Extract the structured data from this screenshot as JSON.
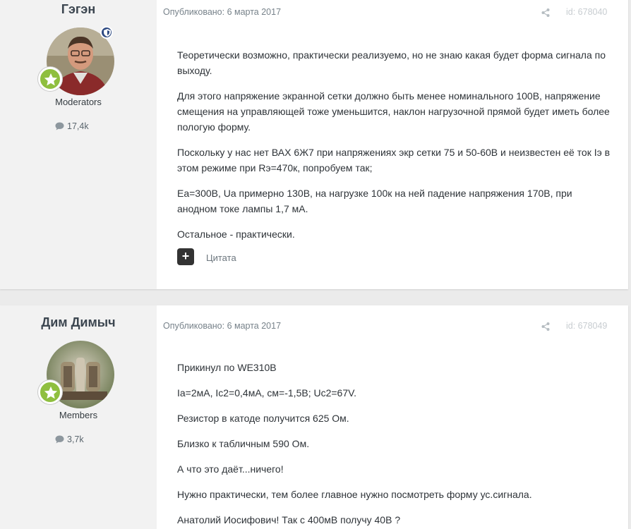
{
  "posts": [
    {
      "author": "Гэгэн",
      "group": "Moderators",
      "count": "17,4k",
      "published": "Опубликовано: 6 марта 2017",
      "post_id": "id: 678040",
      "paragraphs": [
        "Теоретически возможно, практически реализуемо, но не знаю какая будет форма сигнала по выходу.",
        "Для этого напряжение экранной сетки должно быть менее номинального 100В, напряжение смещения на управляющей тоже уменьшится, наклон нагрузочной прямой будет иметь более пологую форму.",
        "Поскольку у нас нет ВАХ 6Ж7 при напряжениях экр сетки 75 и 50-60В и неизвестен её ток Iэ в этом режиме при Rэ=470к, попробуем так;",
        "Еа=300В, Ua примерно 130В, на нагрузке 100к на ней падение напряжения 170В, при анодном токе лампы 1,7 мА.",
        "Остальное - практически."
      ],
      "quote_label": "Цитата"
    },
    {
      "author": "Дим Димыч",
      "group": "Members",
      "count": "3,7k",
      "published": "Опубликовано: 6 марта 2017",
      "post_id": "id: 678049",
      "paragraphs": [
        "Прикинул по WE310B",
        "Ia=2мА, Ic2=0,4мА, cм=-1,5В; Uc2=67V.",
        "Резистор в катоде получится 625 Ом.",
        "Близко к табличным 590 Ом.",
        "А что это даёт...ничего!",
        "Нужно практически, тем более главное нужно посмотреть форму ус.сигнала.",
        "Анатолий Иосифович! Так с 400мВ получу 40В ?"
      ]
    }
  ],
  "icons": {
    "comment": "comment-icon",
    "share": "share-icon",
    "rank": "star-icon",
    "moderator": "shield-icon"
  },
  "colors": {
    "rank_badge": "#8fbf3f",
    "moderator_badge": "#2e4a82",
    "quote_button": "#333333"
  }
}
